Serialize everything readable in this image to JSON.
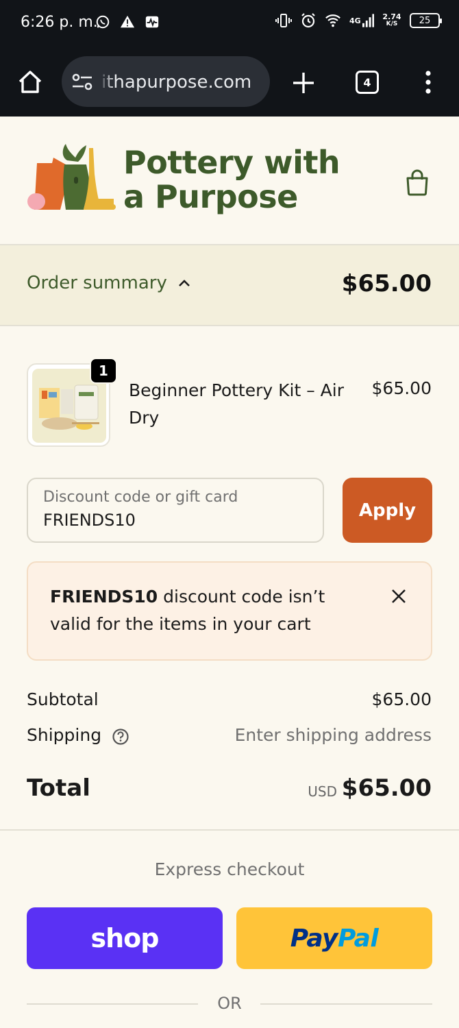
{
  "status_bar": {
    "time": "6:26 p. m.",
    "network_label": "4G",
    "speed_value": "2.74",
    "speed_unit": "K/S",
    "battery_level": "25"
  },
  "browser": {
    "url": "ithapurpose.com",
    "tab_count": "4"
  },
  "store": {
    "logo_line1": "Pottery with",
    "logo_line2": "a Purpose"
  },
  "summary": {
    "toggle_label": "Order summary",
    "total": "$65.00"
  },
  "product": {
    "quantity": "1",
    "name": "Beginner Pottery Kit – Air Dry",
    "price": "$65.00"
  },
  "discount": {
    "label": "Discount code or gift card",
    "value": "FRIENDS10",
    "apply_label": "Apply"
  },
  "alert": {
    "code": "FRIENDS10",
    "message": " discount code isn’t valid for the items in your cart"
  },
  "totals": {
    "subtotal_label": "Subtotal",
    "subtotal_value": "$65.00",
    "shipping_label": "Shipping",
    "shipping_value": "Enter shipping address",
    "total_label": "Total",
    "currency": "USD",
    "total_value": "$65.00"
  },
  "express": {
    "label": "Express checkout",
    "shop_label": "shop",
    "paypal_pay": "Pay",
    "paypal_pal": "Pal",
    "or_label": "OR"
  },
  "colors": {
    "brand_green": "#3d5a2a",
    "apply_orange": "#cc5a24",
    "shop_purple": "#5a31f4",
    "paypal_yellow": "#ffc439"
  }
}
